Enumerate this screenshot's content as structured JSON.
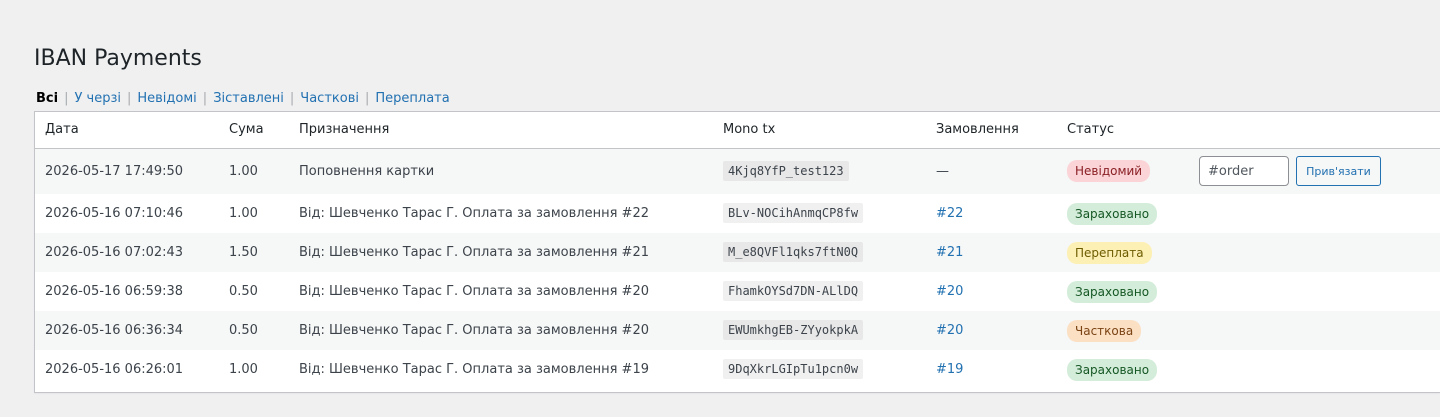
{
  "page": {
    "title": "IBAN Payments"
  },
  "filters": [
    {
      "label": "Всі",
      "current": true
    },
    {
      "label": "У черзі",
      "current": false
    },
    {
      "label": "Невідомі",
      "current": false
    },
    {
      "label": "Зіставлені",
      "current": false
    },
    {
      "label": "Часткові",
      "current": false
    },
    {
      "label": "Переплата",
      "current": false
    }
  ],
  "table": {
    "columns": [
      "Дата",
      "Сума",
      "Призначення",
      "Mono tx",
      "Замовлення",
      "Статус"
    ],
    "rows": [
      {
        "date": "2026-05-17 17:49:50",
        "amount": "1.00",
        "purpose": "Поповнення картки",
        "tx": "4Kjq8YfP_test123",
        "order": "—",
        "status": "Невідомий",
        "status_kind": "unknown"
      },
      {
        "date": "2026-05-16 07:10:46",
        "amount": "1.00",
        "purpose": "Від: Шевченко Тарас Г. Оплата за замовлення #22",
        "tx": "BLv-NOCihAnmqCP8fw",
        "order": "#22",
        "status": "Зараховано",
        "status_kind": "credited"
      },
      {
        "date": "2026-05-16 07:02:43",
        "amount": "1.50",
        "purpose": "Від: Шевченко Тарас Г. Оплата за замовлення #21",
        "tx": "M_e8QVFl1qks7ftN0Q",
        "order": "#21",
        "status": "Переплата",
        "status_kind": "over"
      },
      {
        "date": "2026-05-16 06:59:38",
        "amount": "0.50",
        "purpose": "Від: Шевченко Тарас Г. Оплата за замовлення #20",
        "tx": "FhamkOYSd7DN-ALlDQ",
        "order": "#20",
        "status": "Зараховано",
        "status_kind": "credited"
      },
      {
        "date": "2026-05-16 06:36:34",
        "amount": "0.50",
        "purpose": "Від: Шевченко Тарас Г. Оплата за замовлення #20",
        "tx": "EWUmkhgEB-ZYyokpkA",
        "order": "#20",
        "status": "Часткова",
        "status_kind": "partial"
      },
      {
        "date": "2026-05-16 06:26:01",
        "amount": "1.00",
        "purpose": "Від: Шевченко Тарас Г. Оплата за замовлення #19",
        "tx": "9DqXkrLGIpTu1pcn0w",
        "order": "#19",
        "status": "Зараховано",
        "status_kind": "credited"
      }
    ]
  },
  "assign": {
    "placeholder": "#order",
    "button_label": "Прив'язати"
  }
}
